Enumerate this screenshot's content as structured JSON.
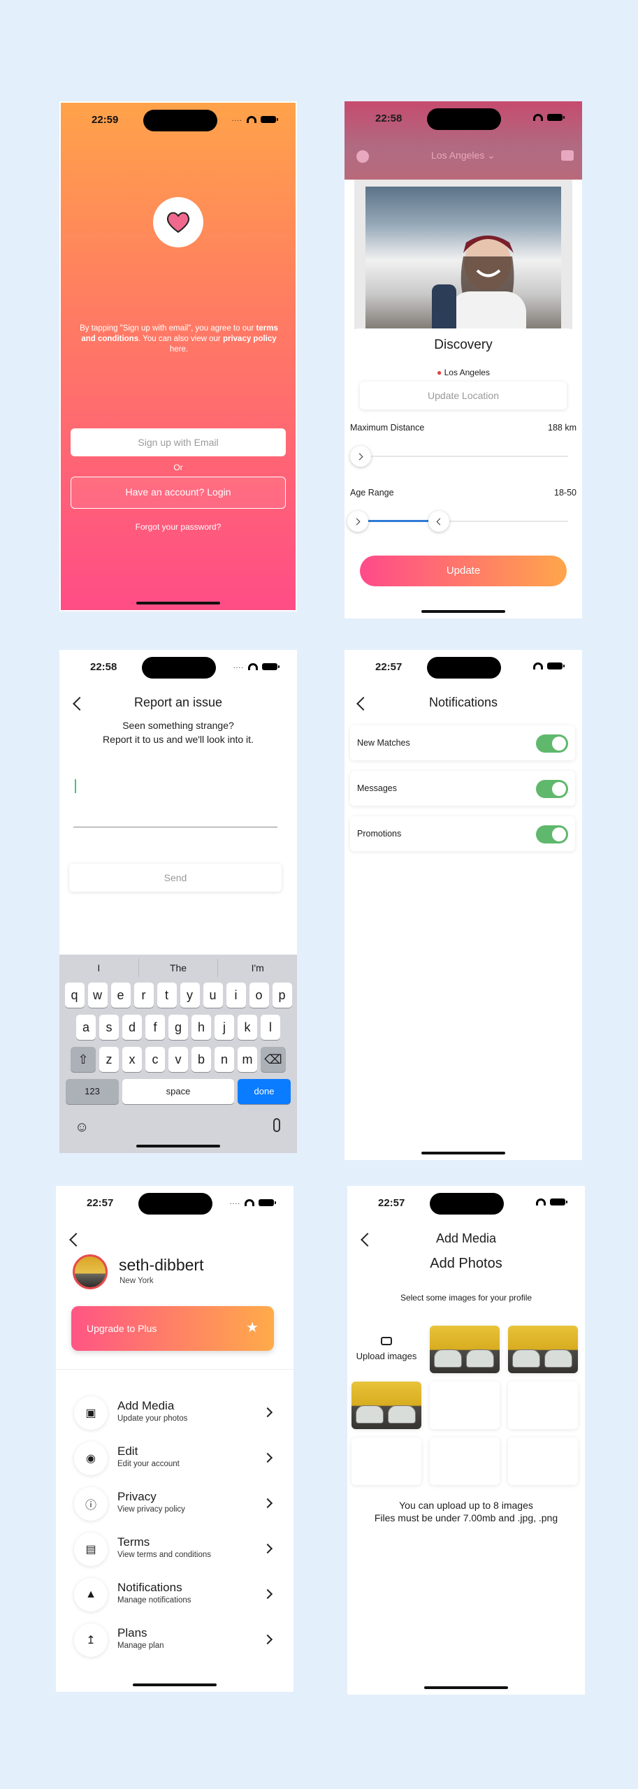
{
  "status": {
    "t1": "22:59",
    "t2": "22:58",
    "t3": "22:58",
    "t4": "22:57",
    "t5": "22:57",
    "t6": "22:57",
    "dots": "...."
  },
  "welcome": {
    "legal_pre": "By tapping \"Sign up with email\", you agree to our",
    "terms": "terms and conditions",
    "legal_mid": ". You can also view our",
    "privacy": "privacy policy",
    "legal_post": "here.",
    "signup": "Sign up with Email",
    "or": "Or",
    "login": "Have an account? Login",
    "forgot": "Forgot your password?"
  },
  "discovery": {
    "city": "Los Angeles",
    "title": "Discovery",
    "location": "Los Angeles",
    "update_location": "Update Location",
    "max_distance_label": "Maximum Distance",
    "max_distance_value": "188 km",
    "age_range_label": "Age Range",
    "age_range_value": "18-50",
    "update": "Update"
  },
  "report": {
    "title": "Report an issue",
    "line1": "Seen something strange?",
    "line2": "Report it to us and we'll look into it.",
    "send": "Send",
    "suggestions": [
      "I",
      "The",
      "I'm"
    ],
    "row1": [
      "q",
      "w",
      "e",
      "r",
      "t",
      "y",
      "u",
      "i",
      "o",
      "p"
    ],
    "row2": [
      "a",
      "s",
      "d",
      "f",
      "g",
      "h",
      "j",
      "k",
      "l"
    ],
    "row3": [
      "z",
      "x",
      "c",
      "v",
      "b",
      "n",
      "m"
    ],
    "key_123": "123",
    "key_space": "space",
    "key_done": "done"
  },
  "notifications": {
    "title": "Notifications",
    "items": [
      {
        "label": "New Matches",
        "on": true
      },
      {
        "label": "Messages",
        "on": true
      },
      {
        "label": "Promotions",
        "on": true
      }
    ]
  },
  "profile": {
    "username": "seth-dibbert",
    "city": "New York",
    "upgrade": "Upgrade to Plus",
    "menu": [
      {
        "title": "Add Media",
        "sub": "Update your photos"
      },
      {
        "title": "Edit",
        "sub": "Edit your account"
      },
      {
        "title": "Privacy",
        "sub": "View privacy policy"
      },
      {
        "title": "Terms",
        "sub": "View terms and conditions"
      },
      {
        "title": "Notifications",
        "sub": "Manage notifications"
      },
      {
        "title": "Plans",
        "sub": "Manage plan"
      }
    ]
  },
  "media": {
    "nav_title": "Add Media",
    "title": "Add Photos",
    "subtitle": "Select some images for your profile",
    "upload": "Upload images",
    "info1": "You can upload up to 8 images",
    "info2": "Files must be under 7.00mb and .jpg, .png"
  },
  "colors": {
    "brand_pink": "#ff4d86",
    "brand_orange": "#ffa24a",
    "toggle_on": "#5fb86c",
    "key_done": "#0a7cff"
  }
}
